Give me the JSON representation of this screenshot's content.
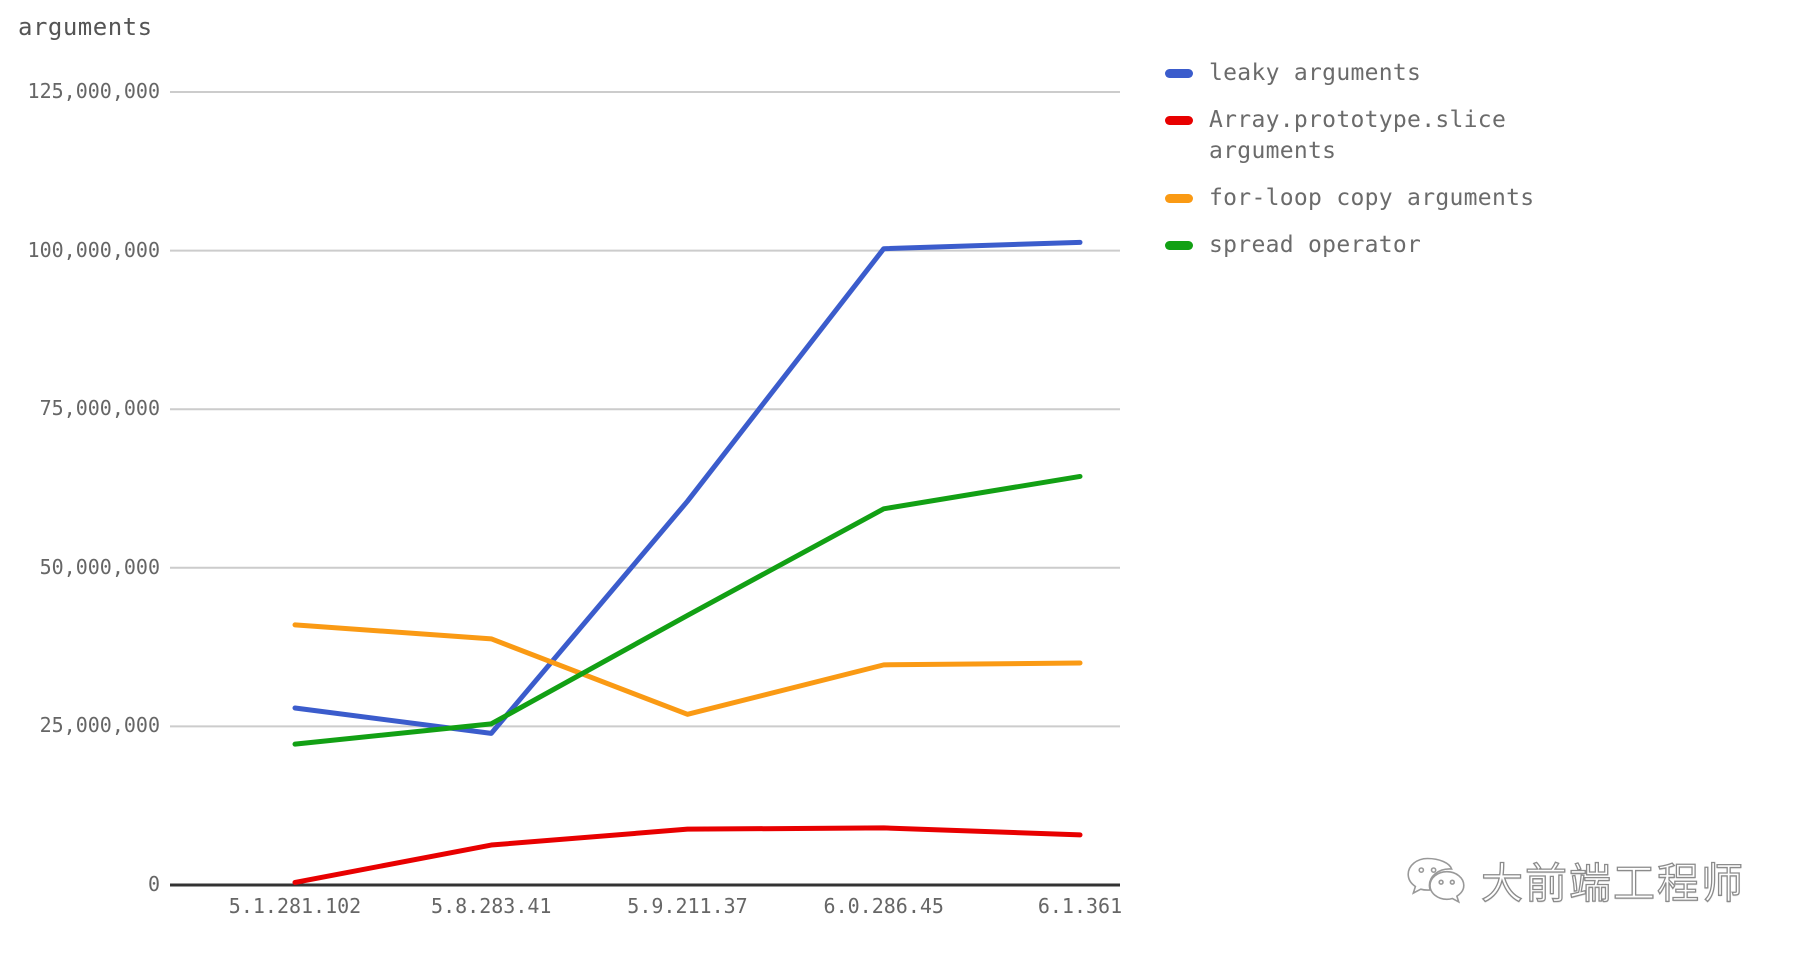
{
  "chart_data": {
    "type": "line",
    "title": "arguments",
    "xlabel": "",
    "ylabel": "",
    "categories": [
      "5.1.281.102",
      "5.8.283.41",
      "5.9.211.37",
      "6.0.286.45",
      "6.1.361"
    ],
    "ylim": [
      0,
      125000000
    ],
    "yticks": [
      0,
      25000000,
      50000000,
      75000000,
      100000000,
      125000000
    ],
    "ytick_labels": [
      "0",
      "25,000,000",
      "50,000,000",
      "75,000,000",
      "100,000,000",
      "125,000,000"
    ],
    "grid": true,
    "legend_position": "right",
    "series": [
      {
        "name": "leaky arguments",
        "color": "#3B5CCC",
        "values": [
          27900000,
          23900000,
          60500000,
          100300000,
          101300000
        ]
      },
      {
        "name": "Array.prototype.slice arguments",
        "color": "#E80000",
        "values": [
          400000,
          6300000,
          8800000,
          9000000,
          7900000
        ]
      },
      {
        "name": "for-loop copy arguments",
        "color": "#FA9A14",
        "values": [
          41000000,
          38800000,
          26900000,
          34700000,
          35000000
        ]
      },
      {
        "name": "spread operator",
        "color": "#12A014",
        "values": [
          22200000,
          25400000,
          42500000,
          59300000,
          64400000
        ]
      }
    ]
  },
  "legend": {
    "items": [
      {
        "label": "leaky arguments",
        "color": "#3B5CCC",
        "name": "legend-item-leaky-arguments"
      },
      {
        "label": "Array.prototype.slice\narguments",
        "color": "#E80000",
        "name": "legend-item-array-prototype-slice-arguments"
      },
      {
        "label": "for-loop copy arguments",
        "color": "#FA9A14",
        "name": "legend-item-for-loop-copy-arguments"
      },
      {
        "label": "spread operator",
        "color": "#12A014",
        "name": "legend-item-spread-operator"
      }
    ]
  },
  "watermark": {
    "text": "大前端工程师",
    "icon": "wechat-icon"
  },
  "colors": {
    "gridline": "#CCCCCC",
    "axis": "#333333",
    "tick_text": "#666666",
    "title_text": "#555555"
  }
}
